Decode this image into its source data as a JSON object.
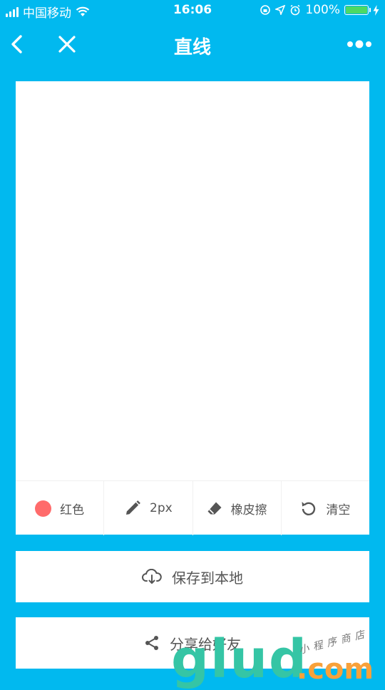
{
  "status_bar": {
    "carrier": "中国移动",
    "time": "16:06",
    "battery_percent": "100%",
    "battery_level": 1.0
  },
  "nav": {
    "title": "直线",
    "back_icon": "chevron-left-icon",
    "close_icon": "close-icon",
    "more_icon": "more-dots-icon"
  },
  "toolbar": {
    "color_label": "红色",
    "color_value": "#ff6b6b",
    "width_label": "2px",
    "eraser_label": "橡皮擦",
    "clear_label": "清空"
  },
  "actions": {
    "save_label": "保存到本地",
    "share_label": "分享给好友"
  },
  "watermark": {
    "brand": "glud",
    "domain": ".com",
    "tagline": "小程序商店"
  }
}
